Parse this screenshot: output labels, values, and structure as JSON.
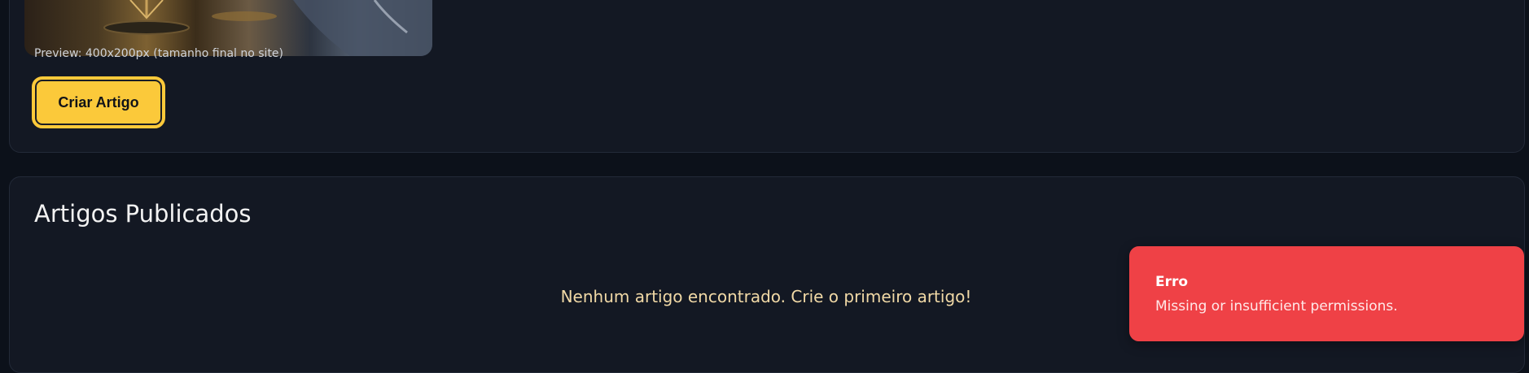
{
  "form": {
    "preview_caption": "Preview: 400x200px (tamanho final no site)",
    "create_button_label": "Criar Artigo"
  },
  "articles": {
    "title": "Artigos Publicados",
    "empty_message": "Nenhum artigo encontrado. Crie o primeiro artigo!"
  },
  "toast": {
    "title": "Erro",
    "message": "Missing or insufficient permissions."
  },
  "colors": {
    "background": "#0c111a",
    "card": "#131823",
    "accent": "#fbc93a",
    "error": "#ef4146",
    "empty_text": "#f1d9a6"
  }
}
